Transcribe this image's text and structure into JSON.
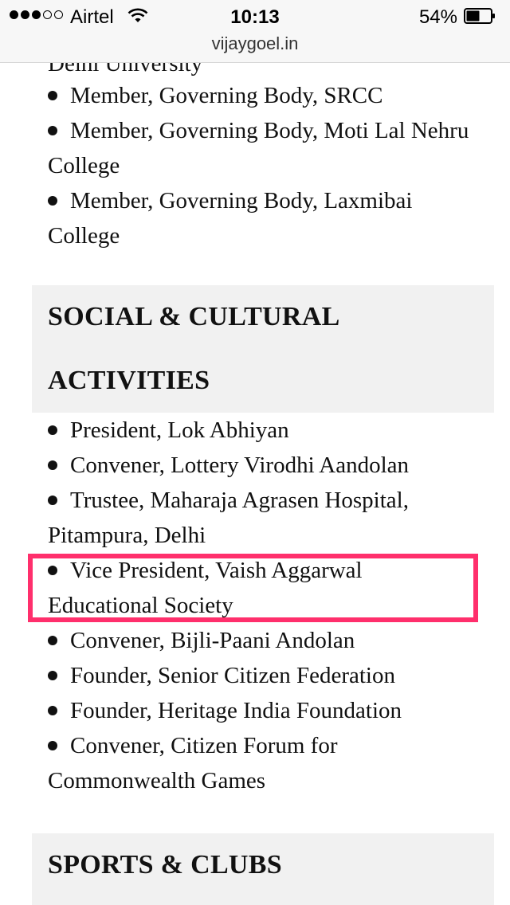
{
  "status_bar": {
    "carrier": "Airtel",
    "time": "10:13",
    "battery_percent": "54%",
    "signal_full": 3,
    "signal_total": 5
  },
  "url_bar": {
    "domain": "vijaygoel.in"
  },
  "partial_heading": "Delhi University",
  "list_top": [
    "Member, Governing Body, SRCC",
    "Member, Governing Body, Moti Lal Nehru College",
    "Member, Governing Body, Laxmibai College"
  ],
  "section_social": {
    "title": "SOCIAL & CULTURAL ACTIVITIES"
  },
  "list_social": [
    "President, Lok Abhiyan",
    "Convener, Lottery Virodhi Aandolan",
    "Trustee, Maharaja Agrasen Hospital, Pitampura, Delhi",
    "Vice President, Vaish Aggarwal Educational Society",
    "Convener, Bijli-Paani Andolan",
    "Founder, Senior Citizen Federation",
    "Founder, Heritage India Foundation",
    "Convener, Citizen Forum for Commonwealth Games"
  ],
  "section_sports": {
    "title": "SPORTS & CLUBS"
  },
  "colors": {
    "highlight_border": "#ff2f6c",
    "section_bg": "#f1f1f1"
  }
}
